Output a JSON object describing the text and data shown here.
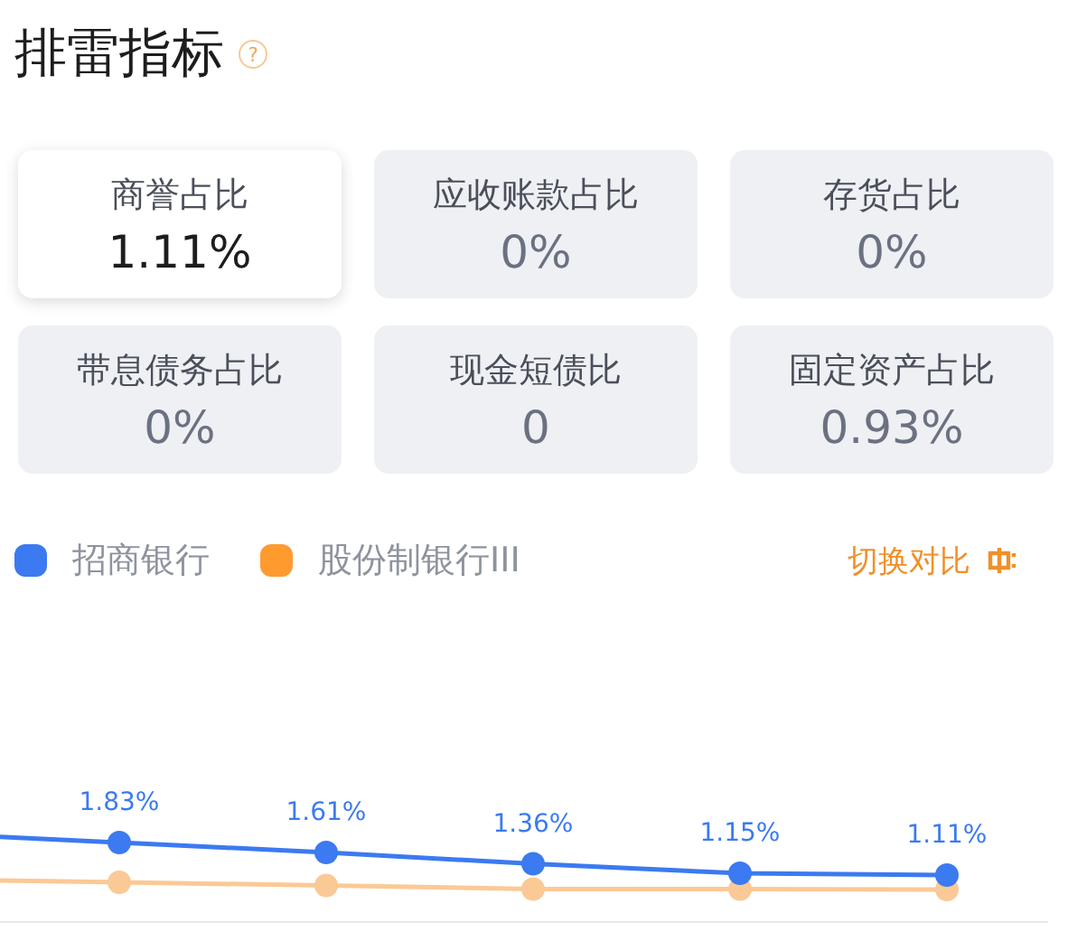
{
  "title": "排雷指标",
  "help_icon": "?",
  "metrics": [
    {
      "label": "商誉占比",
      "value": "1.11%",
      "selected": true
    },
    {
      "label": "应收账款占比",
      "value": "0%",
      "selected": false
    },
    {
      "label": "存货占比",
      "value": "0%",
      "selected": false
    },
    {
      "label": "带息债务占比",
      "value": "0%",
      "selected": false
    },
    {
      "label": "现金短债比",
      "value": "0",
      "selected": false
    },
    {
      "label": "固定资产占比",
      "value": "0.93%",
      "selected": false
    }
  ],
  "legend": [
    {
      "color": "#3b7af0"
    },
    {
      "color": "#ff9a2e"
    }
  ],
  "switch_button": "切换对比",
  "chart": {
    "chart_data": {
      "type": "line",
      "data_labels": "value_labels",
      "series": [
        {
          "name": "招商银行",
          "color": "#3b7af0",
          "marker": "circle",
          "values": [
            1.83,
            1.61,
            1.36,
            1.15,
            1.11
          ],
          "value_labels": [
            "1.83%",
            "1.61%",
            "1.36%",
            "1.15%",
            "1.11%"
          ]
        },
        {
          "name": "股份制银行III",
          "color": "#fbc995",
          "marker": "circle",
          "values": [
            0.95,
            0.88,
            0.8,
            0.8,
            0.79
          ],
          "value_labels": [
            null,
            null,
            null,
            null,
            null
          ]
        }
      ]
    }
  }
}
